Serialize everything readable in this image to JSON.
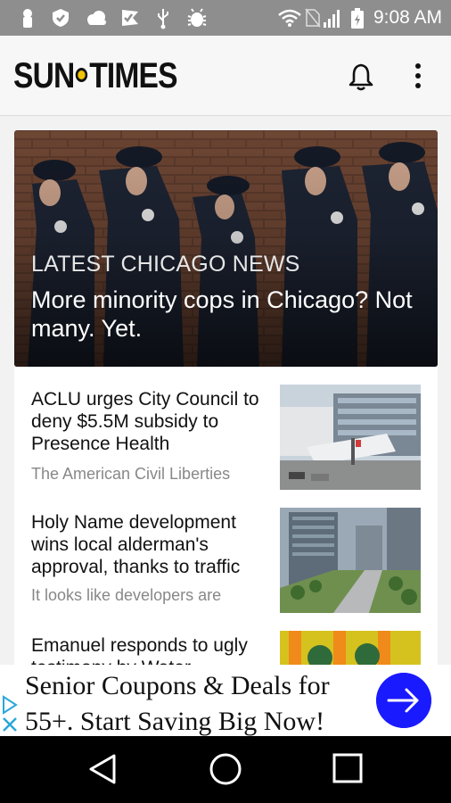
{
  "status_bar": {
    "time": "9:08 AM",
    "icons": [
      "keyhole-icon",
      "shield-icon",
      "cloud-icon",
      "checkbox-flag-icon",
      "usb-icon",
      "android-bug-icon",
      "wifi-icon",
      "no-sim-icon",
      "signal-icon",
      "battery-icon"
    ]
  },
  "app_bar": {
    "logo_left": "SUN",
    "logo_right": "TIMES",
    "icons": [
      "bell-icon",
      "more-vert-icon"
    ]
  },
  "hero": {
    "kicker": "LATEST CHICAGO NEWS",
    "title": "More minority cops in Chicago? Not many. Yet."
  },
  "stories": [
    {
      "title": "ACLU urges City Council to deny $5.5M subsidy to Presence Health",
      "subtitle": "The American Civil Liberties"
    },
    {
      "title": "Holy Name development wins local alderman's approval, thanks to traffic",
      "subtitle": "It looks like developers are"
    },
    {
      "title": "Emanuel responds to ugly testimony by Water",
      "subtitle": ""
    }
  ],
  "ad": {
    "text": "Senior Coupons & Deals for 55+. Start Saving Big Now!",
    "accent": "#1a1aff"
  },
  "nav_bar": {
    "icons": [
      "back-icon",
      "home-icon",
      "recents-icon"
    ]
  }
}
